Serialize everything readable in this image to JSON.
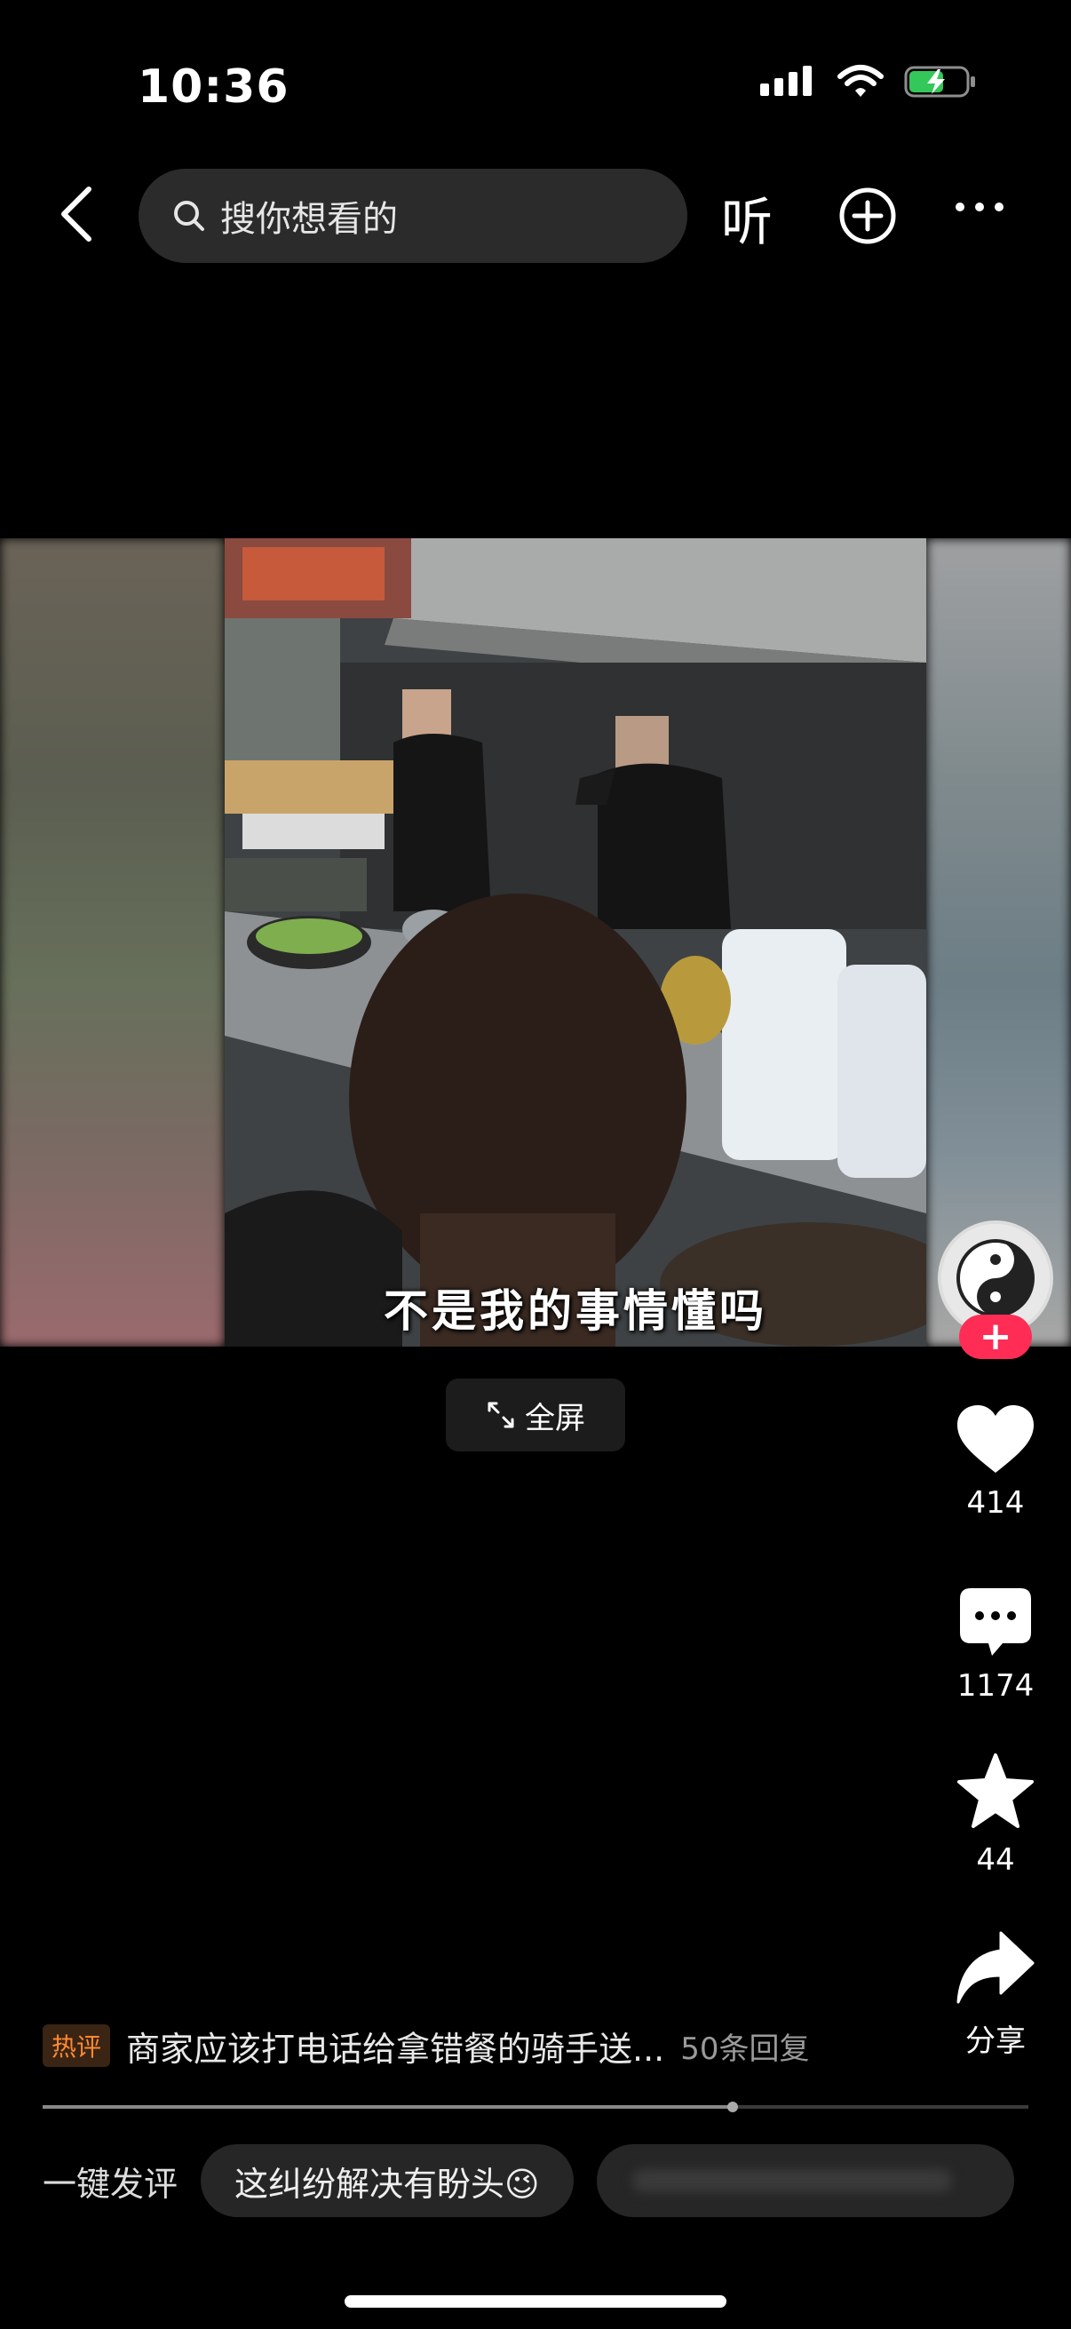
{
  "status_bar": {
    "time": "10:36"
  },
  "header": {
    "search_placeholder": "搜你想看的",
    "listen_label": "听"
  },
  "video": {
    "caption": "不是我的事情懂吗",
    "fullscreen_label": "全屏"
  },
  "actions": {
    "likes": "414",
    "comments": "1174",
    "favorites": "44",
    "share_label": "分享",
    "follow_symbol": "+"
  },
  "hot_comment": {
    "badge": "热评",
    "text": "商家应该打电话给拿错餐的骑手送...",
    "replies": "50条回复"
  },
  "playback": {
    "progress_fraction": 0.7
  },
  "quick_comment": {
    "label": "一键发评",
    "chips": [
      "这纠纷解决有盼头😉"
    ]
  },
  "colors": {
    "follow_accent": "#ff2c55",
    "hot_badge": "#ff8a30"
  }
}
